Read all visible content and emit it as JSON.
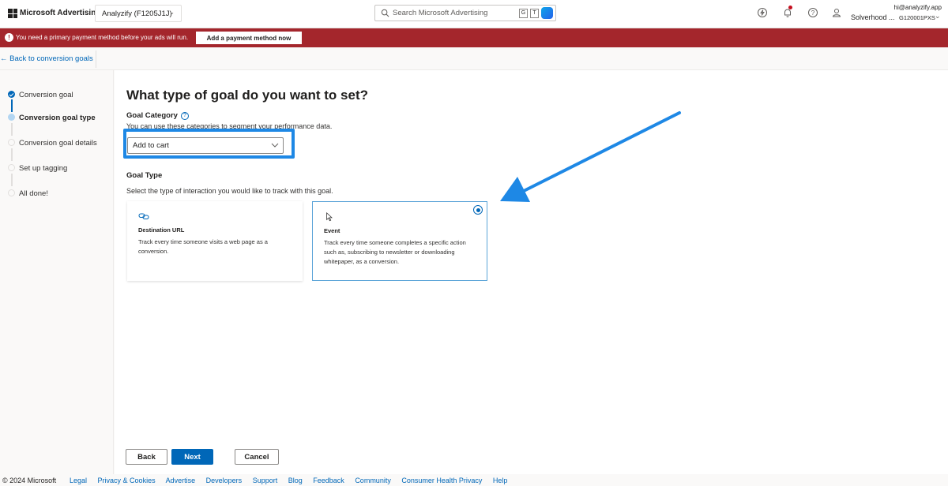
{
  "header": {
    "brand": "Microsoft Advertising",
    "account": "Analyzify (F1205J1J)",
    "search_placeholder": "Search Microsoft Advertising",
    "shortcut_keys": [
      "G",
      "T"
    ],
    "user_email": "hi@analyzify.app",
    "user_name": "Solverhood ...",
    "user_id": "G120001PXS"
  },
  "alert": {
    "message": "You need a primary payment method before your ads will run.",
    "action_label": "Add a payment method now"
  },
  "back_link": "← Back to conversion goals",
  "steps": [
    {
      "label": "Conversion goal",
      "state": "done"
    },
    {
      "label": "Conversion goal type",
      "state": "current"
    },
    {
      "label": "Conversion goal details",
      "state": "todo"
    },
    {
      "label": "Set up tagging",
      "state": "todo"
    },
    {
      "label": "All done!",
      "state": "todo"
    }
  ],
  "main": {
    "title": "What type of goal do you want to set?",
    "goal_category_label": "Goal Category",
    "goal_category_help": "?",
    "goal_category_desc": "You can use these categories to segment your performance data.",
    "goal_category_value": "Add to cart",
    "goal_type_label": "Goal Type",
    "goal_type_desc": "Select the type of interaction you would like to track with this goal.",
    "cards": [
      {
        "title": "Destination URL",
        "desc": "Track every time someone visits a web page as a conversion.",
        "selected": false
      },
      {
        "title": "Event",
        "desc": "Track every time someone completes a specific action such as, subscribing to newsletter or downloading whitepaper, as a conversion.",
        "selected": true
      }
    ]
  },
  "buttons": {
    "back": "Back",
    "next": "Next",
    "cancel": "Cancel"
  },
  "footer": {
    "copyright": "© 2024 Microsoft",
    "links": [
      "Legal",
      "Privacy & Cookies",
      "Advertise",
      "Developers",
      "Support",
      "Blog",
      "Feedback",
      "Community",
      "Consumer Health Privacy",
      "Help"
    ]
  },
  "colors": {
    "accent": "#0067b8",
    "alert": "#a4262c",
    "highlight": "#1e88e5"
  }
}
